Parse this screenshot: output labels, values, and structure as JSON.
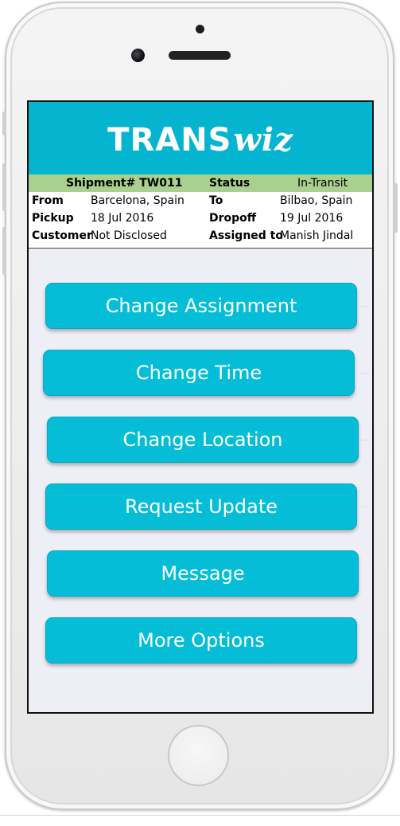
{
  "brand": {
    "logo_main": "TRANS",
    "logo_script": "wiz",
    "header_color": "#05b5cf"
  },
  "shipment": {
    "shipment_label": "Shipment# TW011",
    "status_label": "Status",
    "status_value": "In-Transit",
    "from_label": "From",
    "from_value": "Barcelona, Spain",
    "to_label": "To",
    "to_value": "Bilbao, Spain",
    "pickup_label": "Pickup",
    "pickup_value": "18 Jul 2016",
    "dropoff_label": "Dropoff",
    "dropoff_value": "19 Jul 2016",
    "customer_label": "Customer",
    "customer_value": "Not Disclosed",
    "assigned_label": "Assigned to",
    "assigned_value": "Manish Jindal",
    "header_row_color": "#a9d08e"
  },
  "actions": {
    "change_assignment": "Change Assignment",
    "change_time": "Change Time",
    "change_location": "Change Location",
    "request_update": "Request Update",
    "message": "Message",
    "more_options": "More Options",
    "button_color": "#05bdd7"
  },
  "device": {
    "home_button_icon": "home-button-icon",
    "camera_icon": "front-camera-icon"
  }
}
